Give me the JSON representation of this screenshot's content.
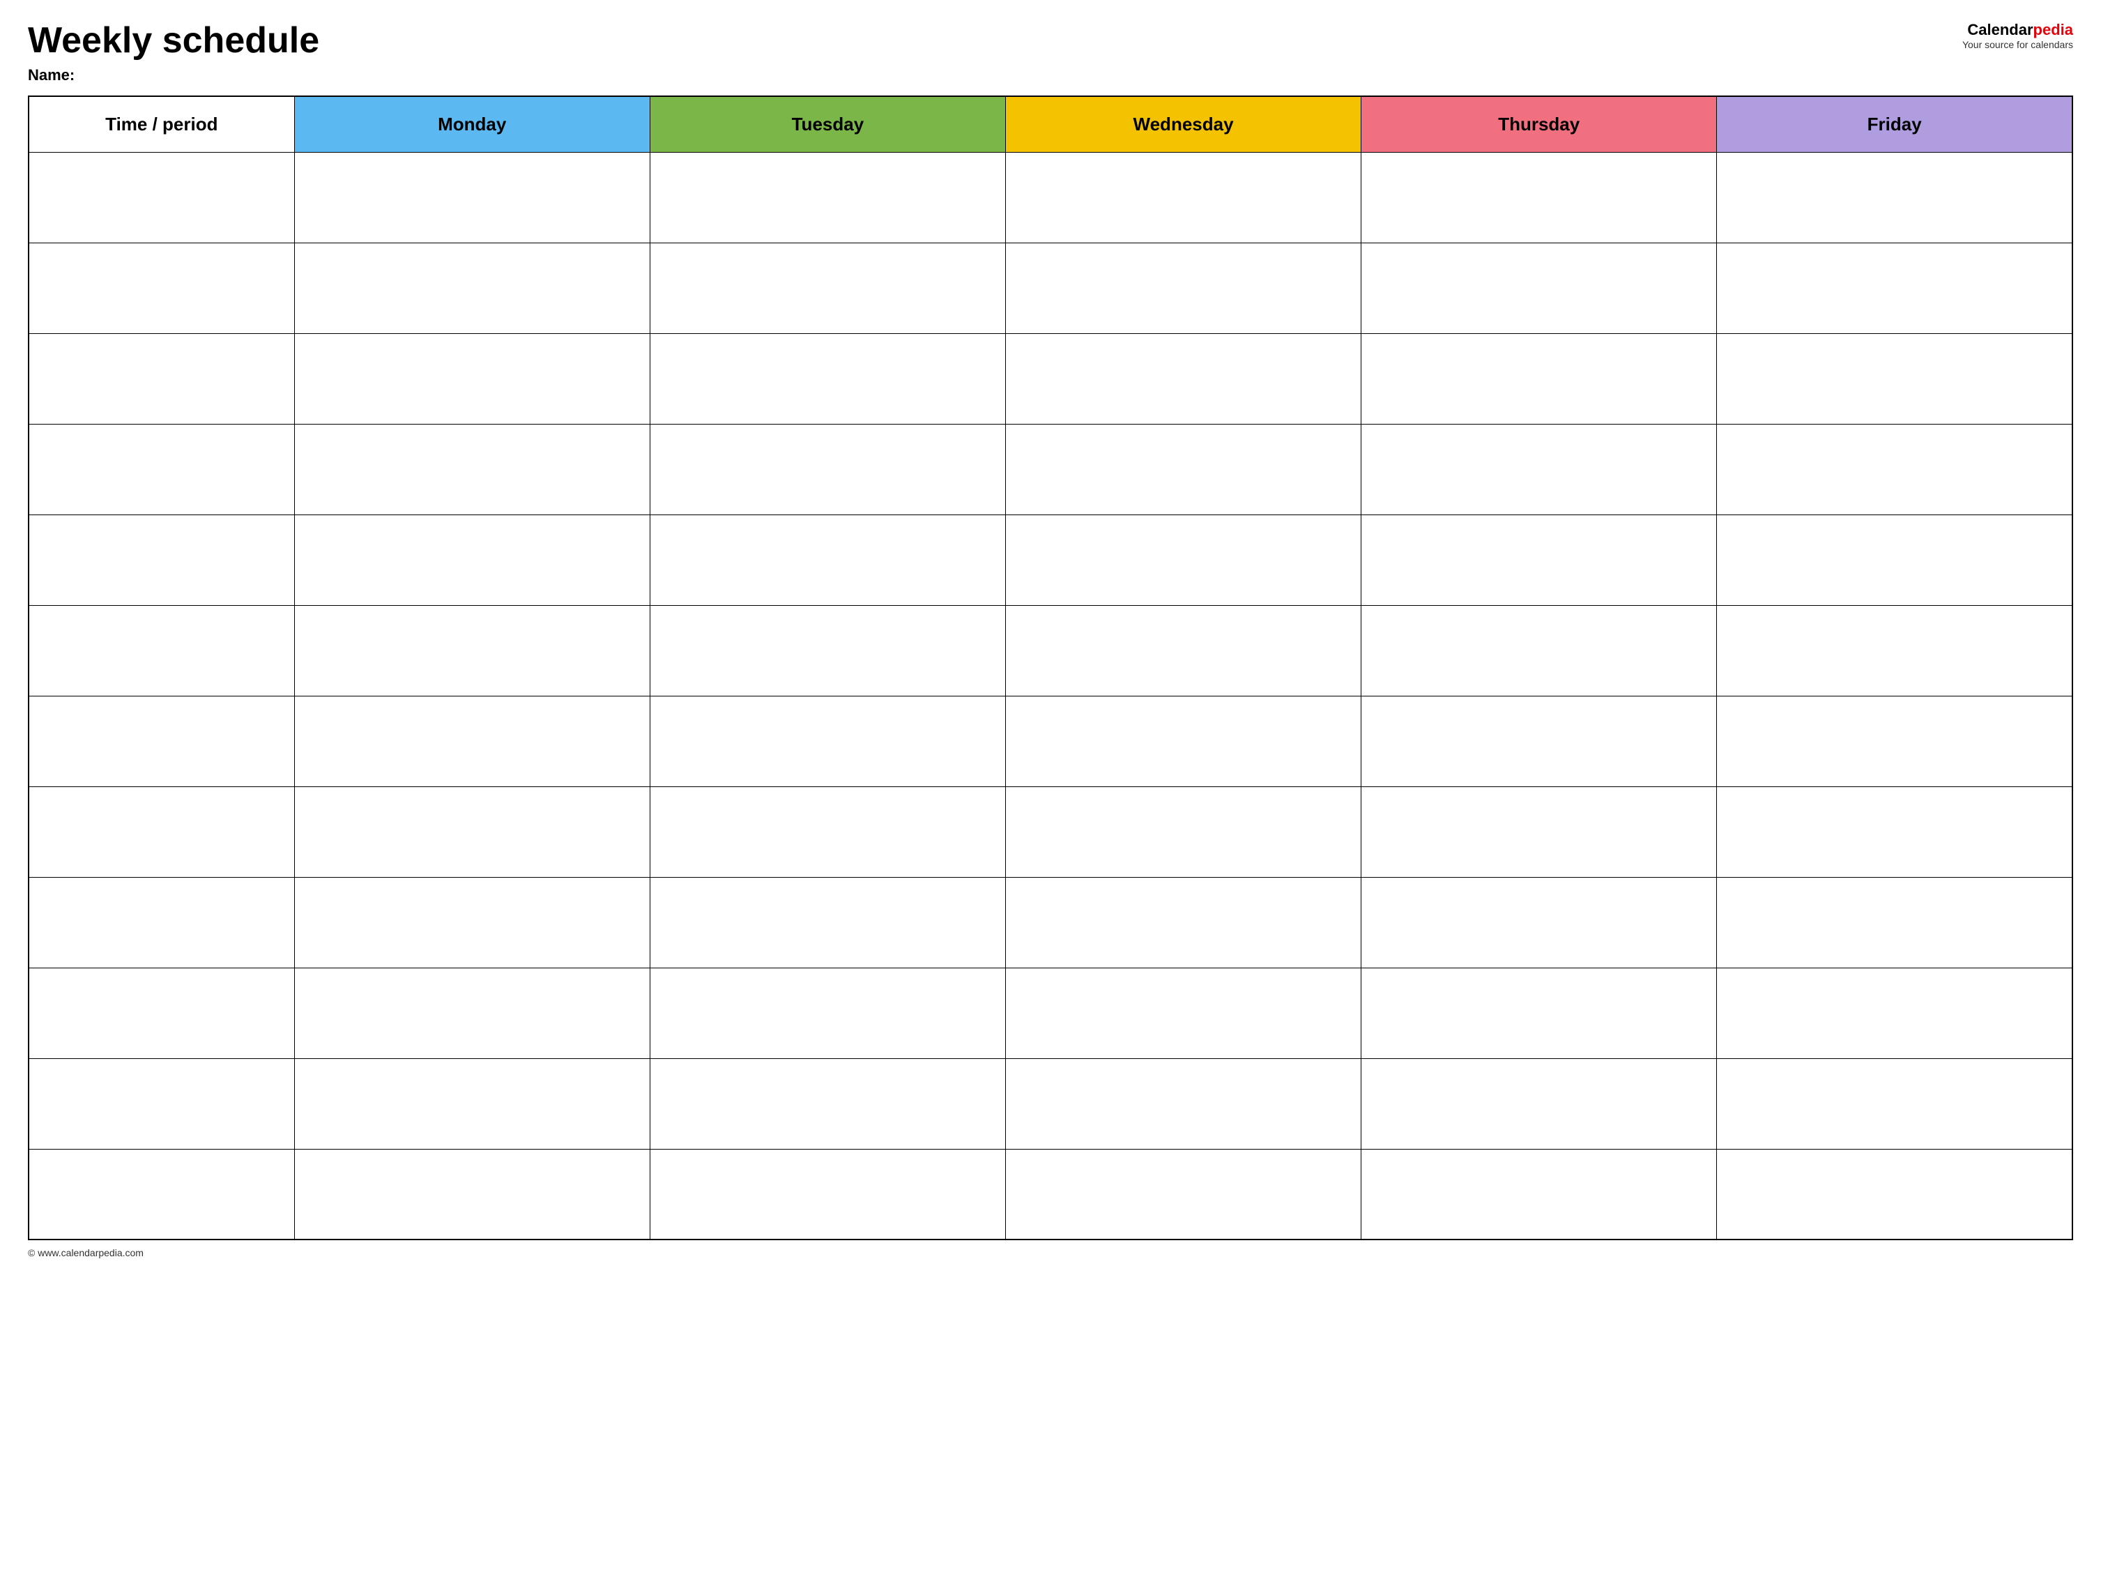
{
  "header": {
    "title": "Weekly schedule",
    "name_label": "Name:",
    "logo_calendar": "Calendar",
    "logo_pedia": "pedia",
    "logo_tagline": "Your source for calendars"
  },
  "table": {
    "columns": [
      {
        "id": "time",
        "label": "Time / period",
        "color": "#ffffff"
      },
      {
        "id": "monday",
        "label": "Monday",
        "color": "#5cb8f0"
      },
      {
        "id": "tuesday",
        "label": "Tuesday",
        "color": "#7ab648"
      },
      {
        "id": "wednesday",
        "label": "Wednesday",
        "color": "#f5c200"
      },
      {
        "id": "thursday",
        "label": "Thursday",
        "color": "#f07080"
      },
      {
        "id": "friday",
        "label": "Friday",
        "color": "#b09de0"
      }
    ],
    "row_count": 12
  },
  "footer": {
    "url": "© www.calendarpedia.com"
  }
}
